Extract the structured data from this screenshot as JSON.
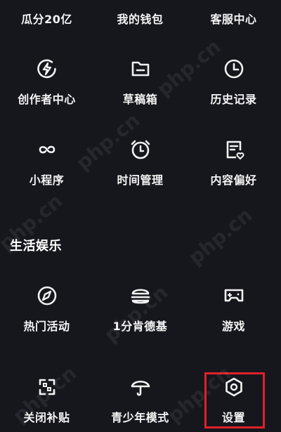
{
  "top_links": [
    {
      "label": "瓜分20亿"
    },
    {
      "label": "我的钱包"
    },
    {
      "label": "客服中心"
    }
  ],
  "grid_row1": [
    {
      "label": "创作者中心",
      "icon": "lightning-circle-icon"
    },
    {
      "label": "草稿箱",
      "icon": "folder-icon"
    },
    {
      "label": "历史记录",
      "icon": "clock-icon"
    }
  ],
  "grid_row2": [
    {
      "label": "小程序",
      "icon": "infinity-link-icon"
    },
    {
      "label": "时间管理",
      "icon": "alarm-clock-icon"
    },
    {
      "label": "内容偏好",
      "icon": "document-heart-icon"
    }
  ],
  "section": {
    "title": "生活娱乐"
  },
  "life_row": [
    {
      "label": "热门活动",
      "icon": "compass-icon"
    },
    {
      "label": "1分肯德基",
      "icon": "burger-icon"
    },
    {
      "label": "游戏",
      "icon": "gamepad-icon"
    }
  ],
  "bottom_row": [
    {
      "label": "关闭补贴",
      "icon": "coupon-frame-icon"
    },
    {
      "label": "青少年模式",
      "icon": "umbrella-icon"
    },
    {
      "label": "设置",
      "icon": "hexagon-gear-icon"
    }
  ],
  "watermark_text": "php.cn",
  "colors": {
    "background": "#16161d",
    "highlight": "#e0202a",
    "text": "#f4f4f4"
  }
}
